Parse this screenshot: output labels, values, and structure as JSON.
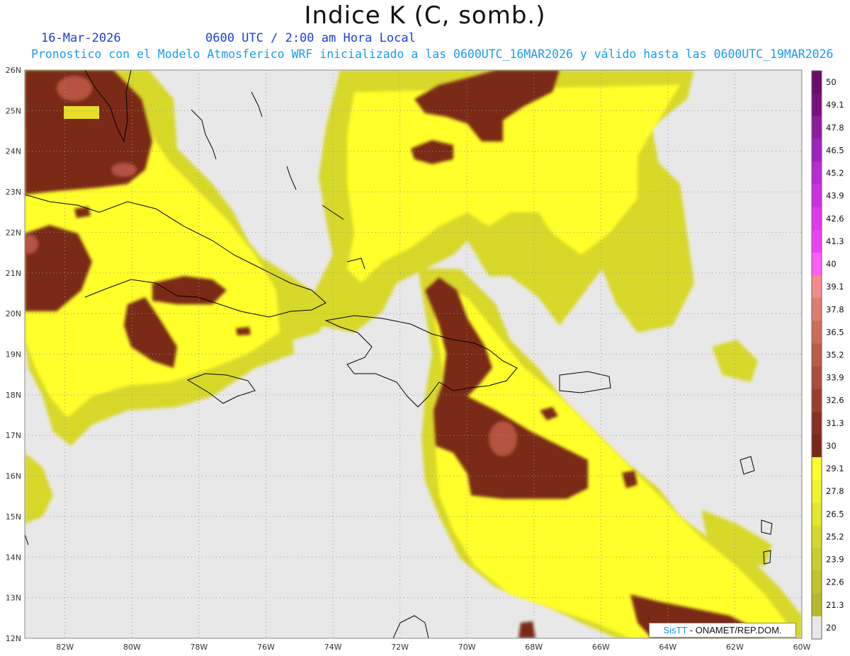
{
  "header": {
    "title": "Indice K (C, somb.)",
    "date": "16-Mar-2026",
    "time": "0600 UTC / 2:00 am Hora Local",
    "subtitle": "Pronostico con el Modelo Atmosferico WRF inicializado a las 0600UTC_16MAR2026 y válido hasta las  0600UTC_19MAR2026"
  },
  "map": {
    "lat_labels": [
      "26N",
      "25N",
      "24N",
      "23N",
      "22N",
      "21N",
      "20N",
      "19N",
      "18N",
      "17N",
      "16N",
      "15N",
      "14N",
      "13N",
      "12N"
    ],
    "lon_labels": [
      "82W",
      "80W",
      "78W",
      "76W",
      "74W",
      "72W",
      "70W",
      "68W",
      "66W",
      "64W",
      "62W",
      "60W"
    ],
    "lat_range": [
      12,
      26
    ],
    "lon_range": [
      -83.2,
      -60
    ],
    "grid": "dotted",
    "background_color": "#e8e8e8"
  },
  "colorbar": {
    "levels": [
      "50",
      "49.1",
      "47.8",
      "46.5",
      "45.2",
      "43.9",
      "42.6",
      "41.3",
      "40",
      "39.1",
      "37.8",
      "36.5",
      "35.2",
      "33.9",
      "32.6",
      "31.3",
      "30",
      "29.1",
      "27.8",
      "26.5",
      "25.2",
      "23.9",
      "22.6",
      "21.3",
      "20"
    ],
    "colors": [
      "#6a0b6e",
      "#7a107e",
      "#8e1ba0",
      "#a020c0",
      "#b82ad2",
      "#cc30e0",
      "#e038ec",
      "#f040f5",
      "#ff5cff",
      "#f58a8a",
      "#e07c6c",
      "#d06a58",
      "#c05a48",
      "#ad4c3a",
      "#9c3e2c",
      "#8a3020",
      "#7a2a14",
      "#ffff2a",
      "#f3f32a",
      "#e6e62a",
      "#d8d82a",
      "#cccc2a",
      "#c2c22a",
      "#b8b82a",
      "#e8e8e8"
    ]
  },
  "credit": {
    "brand": "SisTT",
    "organization": " - ONAMET/REP.DOM."
  }
}
